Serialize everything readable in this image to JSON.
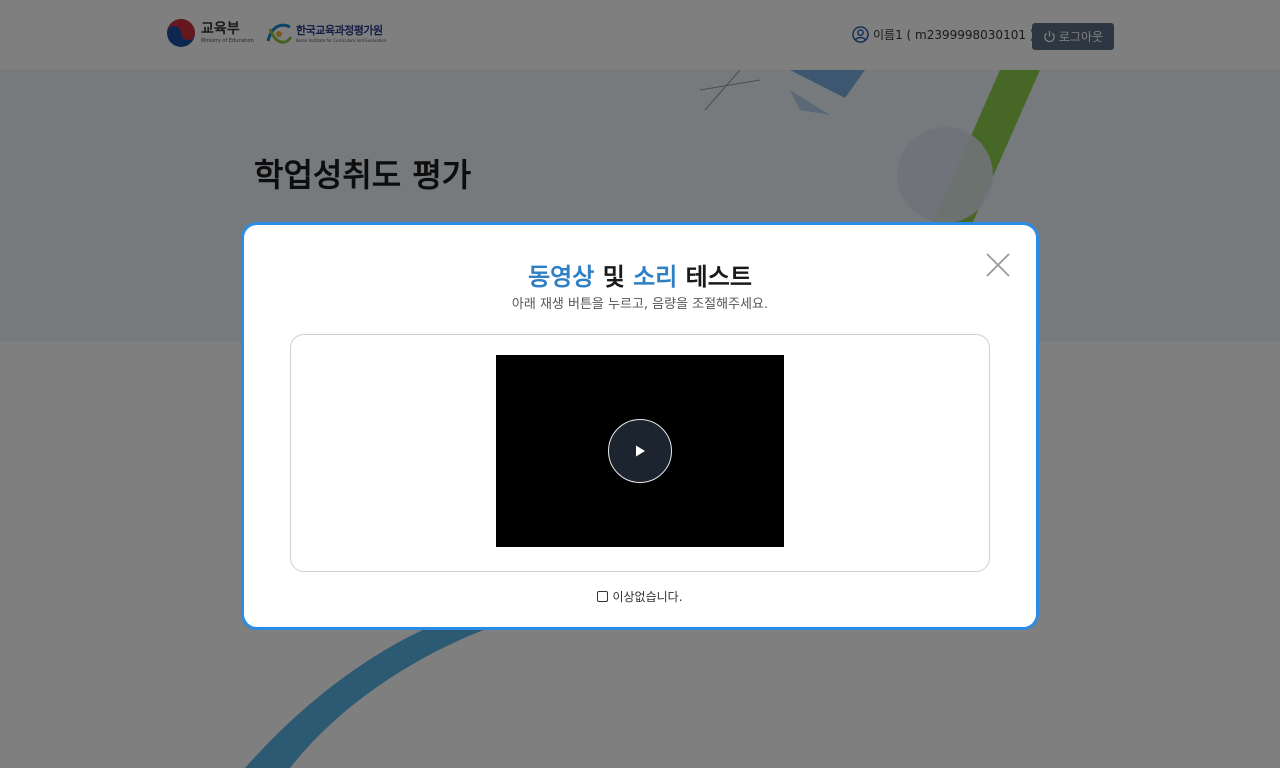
{
  "header": {
    "ministry_kr": "교육부",
    "ministry_en": "Ministry of Education",
    "institute_kr": "한국교육과정평가원",
    "institute_en": "Korea Institute for Curriculum and Evaluation",
    "user_label": "이름1 ( m2399998030101 )",
    "logout_label": "로그아웃"
  },
  "page": {
    "title": "학업성취도 평가"
  },
  "modal": {
    "title_part1": "동영상",
    "title_part2": "및",
    "title_part3": "소리",
    "title_part4": "테스트",
    "subtitle": "아래 재생 버튼을 누르고, 음량을 조절해주세요.",
    "checkbox_label": "이상없습니다.",
    "checked": false
  },
  "colors": {
    "modal_border": "#2b8ce6",
    "title_accent": "#2f7fc4",
    "logout_bg": "#5a6f82"
  },
  "icons": [
    "user-icon",
    "power-icon",
    "close-icon",
    "play-icon"
  ]
}
